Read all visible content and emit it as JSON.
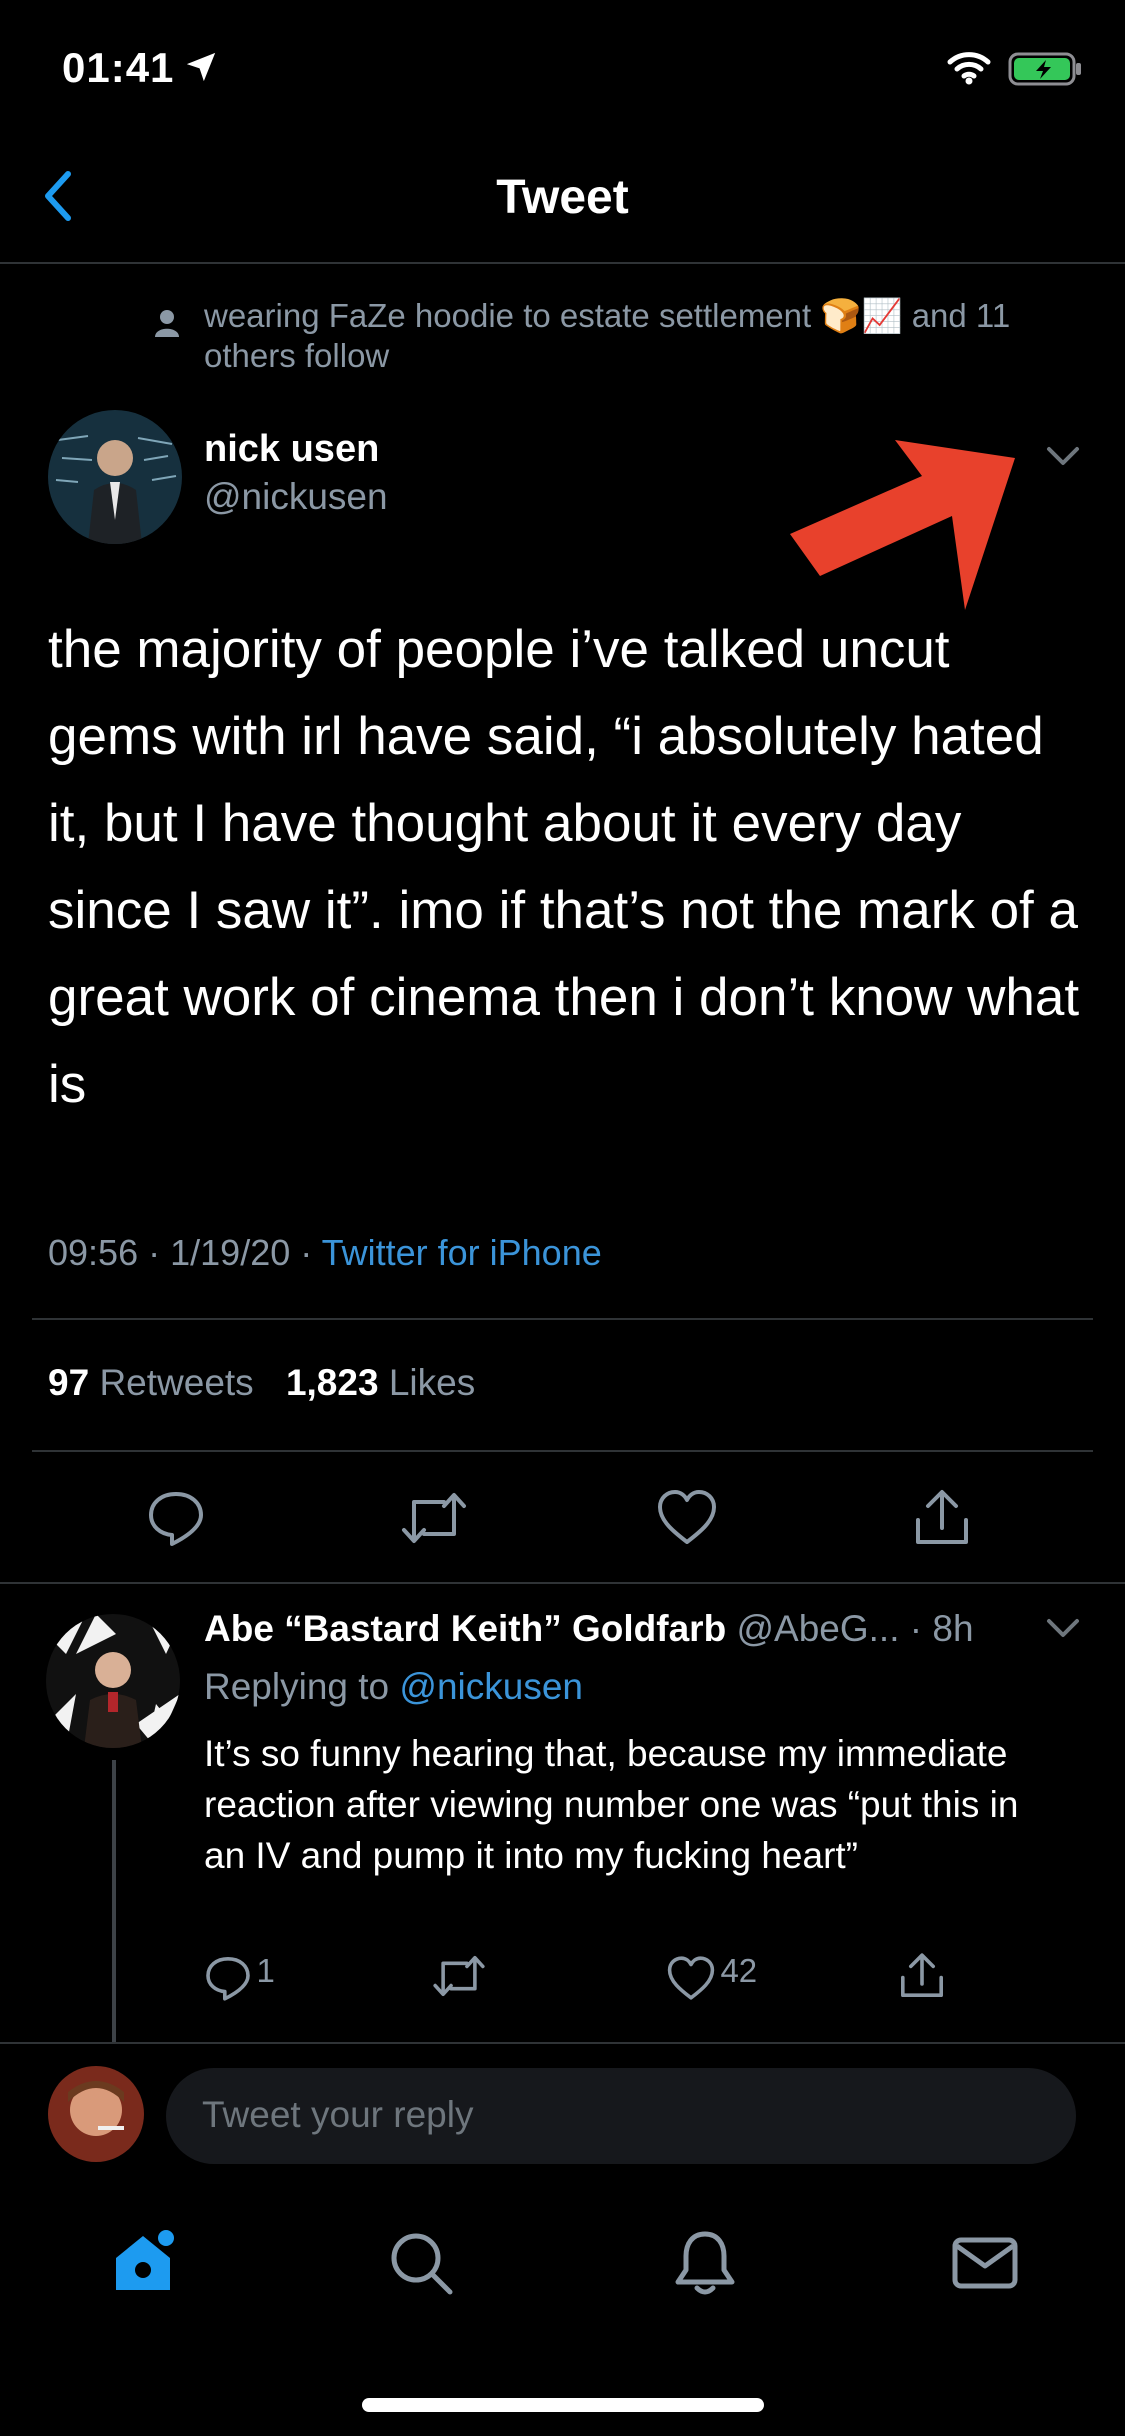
{
  "status_bar": {
    "time": "01:41"
  },
  "header": {
    "title": "Tweet"
  },
  "social_context": {
    "text": "wearing FaZe hoodie to estate settlement 🍞📈 and 11 others follow"
  },
  "tweet": {
    "author_name": "nick usen",
    "author_handle": "@nickusen",
    "text": "the majority of people i’ve talked uncut gems with irl have said, “i absolutely hated it, but I have thought about it every day since I saw it”. imo if that’s not the mark of a great work of cinema then i don’t know what is",
    "time": "09:56",
    "date": "1/19/20",
    "separator": "·",
    "source": "Twitter for iPhone",
    "retweets_count": "97",
    "retweets_label": "Retweets",
    "likes_count": "1,823",
    "likes_label": "Likes"
  },
  "reply": {
    "author_name": "Abe “Bastard Keith” Goldfarb",
    "author_handle": "@AbeG...",
    "time": "· 8h",
    "replying_prefix": "Replying to",
    "replying_handle": "@nickusen",
    "text": "It’s so funny hearing that, because my immediate reaction after viewing number one was “put this in an IV and pump it into my fucking heart”",
    "reply_count": "1",
    "like_count": "42"
  },
  "composer": {
    "placeholder": "Tweet your reply"
  },
  "icons": {
    "back": "chevron-left-icon",
    "caret": "chevron-down-icon",
    "reply": "speech-bubble-icon",
    "retweet": "retweet-icon",
    "like": "heart-icon",
    "share": "share-icon",
    "home": "home-icon",
    "search": "search-icon",
    "notifications": "bell-icon",
    "messages": "mail-icon"
  },
  "colors": {
    "accent": "#1d9bf0",
    "link": "#3b94d9",
    "muted": "#8b98a5",
    "annotation_arrow": "#e8412c",
    "battery": "#34c759"
  }
}
